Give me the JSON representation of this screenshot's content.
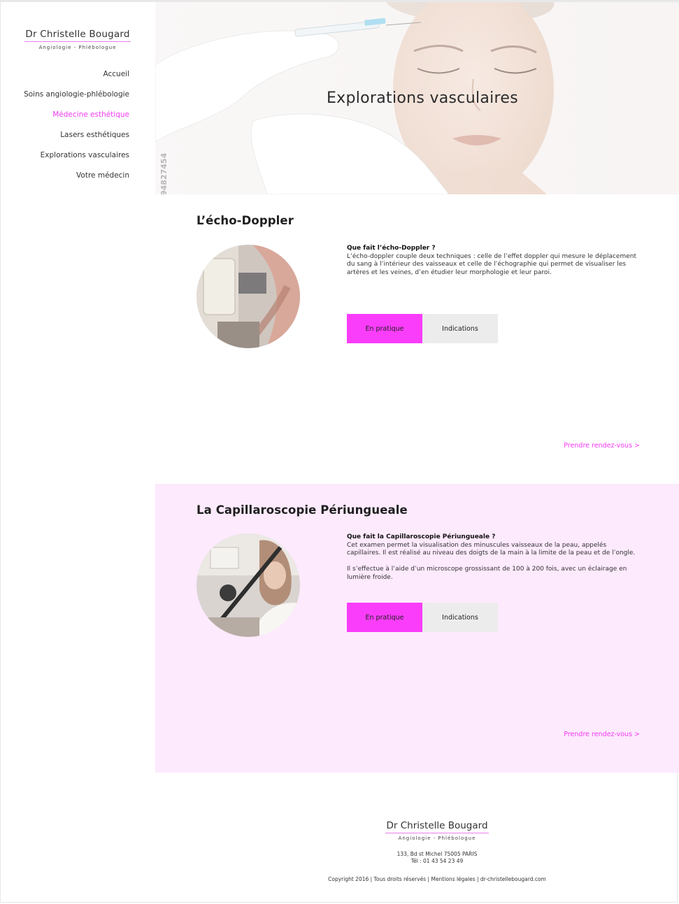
{
  "brand": {
    "name": "Dr Christelle Bougard",
    "subtitle": "Angiologie - Phlébologue"
  },
  "nav": {
    "items": [
      {
        "label": "Accueil",
        "active": false
      },
      {
        "label": "Soins angiologie-phlébologie",
        "active": false
      },
      {
        "label": "Médecine esthétique",
        "active": true
      },
      {
        "label": "Lasers esthétiques",
        "active": false
      },
      {
        "label": "Explorations vasculaires",
        "active": false
      },
      {
        "label": "Votre médecin",
        "active": false
      }
    ]
  },
  "hero": {
    "title": "Explorations vasculaires",
    "watermark": "94827454"
  },
  "sections": [
    {
      "title": "L’écho-Doppler",
      "question": "Que fait l’écho-Doppler ?",
      "paragraphs": [
        "L’écho-doppler couple deux techniques : celle de l’effet doppler qui mesure le déplacement du sang à l’intérieur des vaisseaux et celle de l’échographie qui permet de visualiser les artères et les veines, d’en étudier leur morphologie et leur paroi."
      ],
      "btn_primary": "En pratique",
      "btn_secondary": "Indications",
      "rdv": "Prendre rendez-vous >"
    },
    {
      "title": "La Capillaroscopie Périungueale",
      "question": "Que fait la Capillaroscopie Périungueale ?",
      "paragraphs": [
        "Cet examen permet la visualisation des minuscules vaisseaux de la peau, appelés capillaires. Il est réalisé au niveau des doigts de la main à la limite de la peau et de l’ongle.",
        "Il s’effectue à l’aide d’un microscope grossissant de 100 à 200 fois,  avec un éclairage en lumière froide."
      ],
      "btn_primary": "En pratique",
      "btn_secondary": "Indications",
      "rdv": "Prendre rendez-vous >"
    }
  ],
  "footer": {
    "name": "Dr Christelle Bougard",
    "subtitle": "Angiologie - Phlébologue",
    "address": "133, Bd st Michel 75005 PARIS",
    "phone": "Tél : 01 43 54 23 49",
    "copyright": "Copyright 2016 | Tous droits réservés | Mentions légales | dr-christellebougard.com"
  },
  "colors": {
    "accent": "#fa3dfa",
    "nav_active": "#f33af3",
    "section_alt_bg": "#fdeafd",
    "secondary_button": "#ececec"
  }
}
